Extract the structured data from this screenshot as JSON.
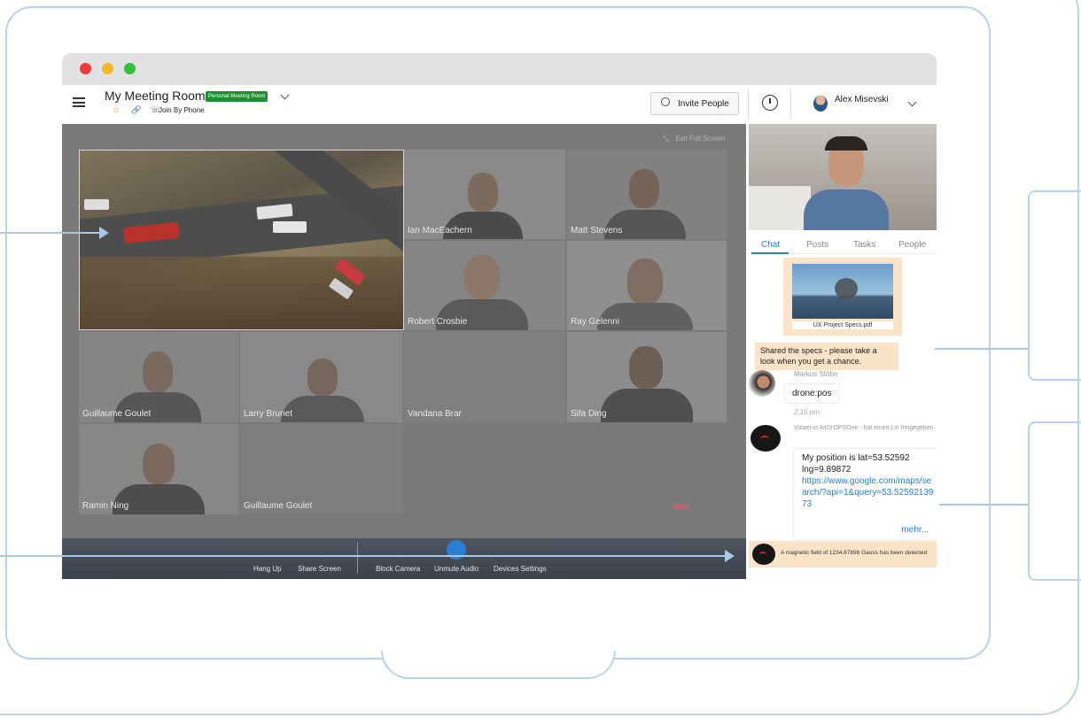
{
  "window": {
    "room_title": "My Meeting Room",
    "badge": "Personal Meeting Room",
    "join_by_phone": "Join By Phone",
    "invite_label": "Invite People",
    "user_name": "Alex Misevski"
  },
  "stage": {
    "exit_full_screen": "Exit Full Screen",
    "beta": "BETA",
    "participants": [
      {
        "name": "Ian MacEachern"
      },
      {
        "name": "Matt Stevens"
      },
      {
        "name": "Robert Crosbie"
      },
      {
        "name": "Ray Gelenni"
      },
      {
        "name": "Guillaume Goulet"
      },
      {
        "name": "Larry Brunet"
      },
      {
        "name": "Vandana Brar"
      },
      {
        "name": "Sifa Ding"
      },
      {
        "name": "Ramin Ning"
      },
      {
        "name": "Guillaume Goulet"
      }
    ]
  },
  "controls": {
    "hang_up": "Hang Up",
    "share_screen": "Share Screen",
    "block_camera": "Block Camera",
    "unmute_audio": "Unmute Audio",
    "devices_settings": "Devices Settings"
  },
  "panel": {
    "tabs": [
      "Chat",
      "Posts",
      "Tasks",
      "People"
    ],
    "active_tab": "Chat",
    "attachment_name": "UX Project Specs.pdf",
    "shared_message": "Shared the specs - please take a look when you get a chance.",
    "msg1_author": "Markus Stöbe",
    "msg1_text": "drone:pos",
    "msg1_time": "2:16 pm",
    "msg2_author": "Volaer.io AirDrOPSOne - hat einen Lin freigegeben",
    "msg2_text": "My position is lat=53.52592 lng=9.89872",
    "msg2_link": "https://www.google.com/maps/search/?api=1&query=53.5259213973",
    "msg2_more": "mehr...",
    "alert_text": "A magnetic field of 1234.67898 Gauss has been detected"
  },
  "colors": {
    "accent": "#2a7fd4",
    "badge": "#1e8f2e",
    "callout": "#a9c8e4",
    "chat_highlight": "#fbe3c8"
  },
  "icons": [
    "hamburger-icon",
    "sun-icon",
    "paperclip-icon",
    "phone-icon",
    "user-icon",
    "clock-icon",
    "avatar",
    "chevron-down-icon",
    "exit-fullscreen-icon",
    "mic-icon"
  ]
}
